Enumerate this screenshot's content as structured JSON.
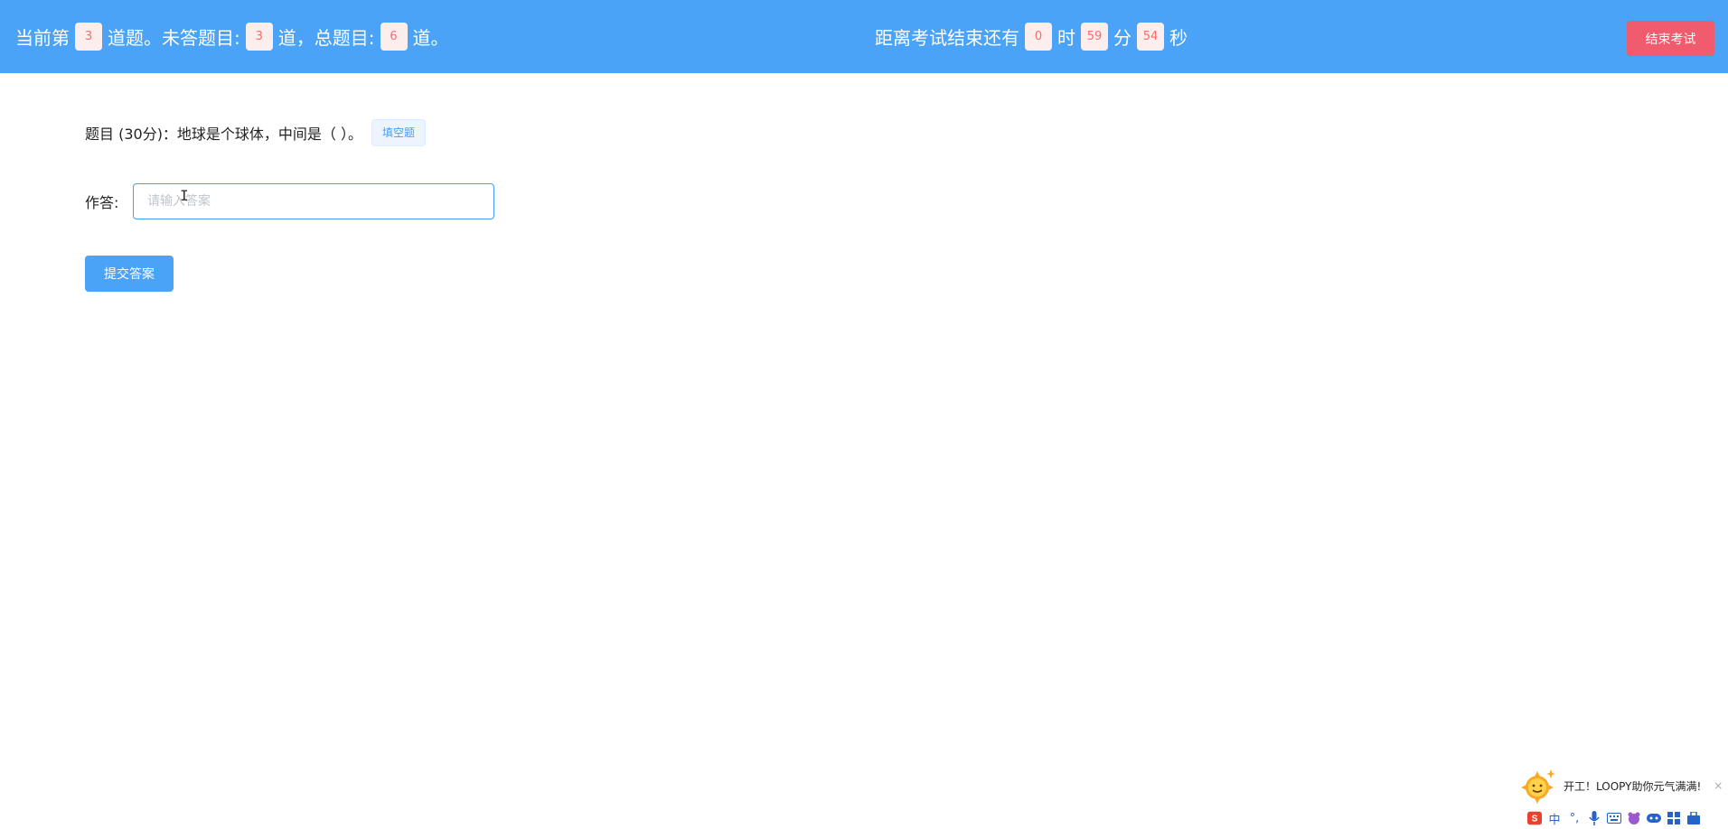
{
  "header": {
    "current_prefix": "当前第",
    "current_index": "3",
    "unanswered_prefix": "道题。未答题目:",
    "unanswered_count": "3",
    "total_prefix": "道，总题目:",
    "total_count": "6",
    "total_suffix": "道。",
    "timer_prefix": "距离考试结束还有",
    "hours": "0",
    "hours_unit": "时",
    "minutes": "59",
    "minutes_unit": "分",
    "seconds": "54",
    "seconds_unit": "秒",
    "end_exam_label": "结束考试"
  },
  "question": {
    "text": "题目 (30分)：地球是个球体，中间是（ ）。",
    "type_tag": "填空题"
  },
  "answer": {
    "label": "作答:",
    "placeholder": "请输入答案",
    "value": ""
  },
  "submit_label": "提交答案",
  "ime": {
    "message": "开工！LOOPY助你元气满满!",
    "close": "×",
    "logo": "S",
    "lang": "中",
    "punct": "°,",
    "icons": [
      "s-logo-icon",
      "chinese-mode-icon",
      "punctuation-icon",
      "microphone-icon",
      "keyboard-icon",
      "skin-icon",
      "game-icon",
      "grid-icon",
      "toolbox-icon"
    ]
  }
}
